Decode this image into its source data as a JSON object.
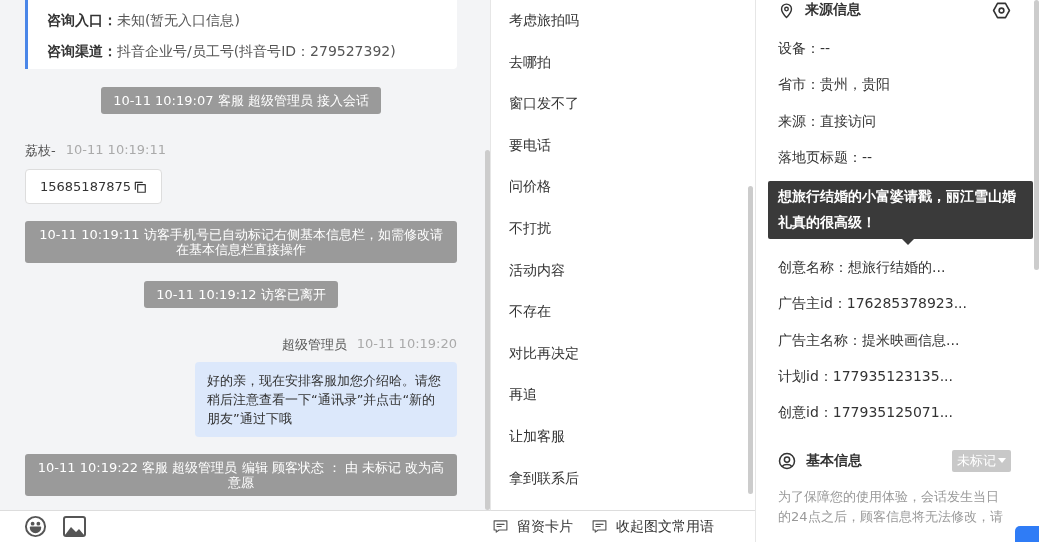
{
  "info_card": {
    "rows": [
      {
        "label": "咨询入口：",
        "value": "未知(暂无入口信息)"
      },
      {
        "label": "咨询渠道：",
        "value": "抖音企业号/员工号(抖音号ID：279527392)"
      }
    ]
  },
  "messages": [
    {
      "kind": "system",
      "text": "10-11 10:19:07 客服 超级管理员 接入会话"
    },
    {
      "kind": "received",
      "sender": "荔枝-",
      "time": "10-11 10:19:11",
      "text": "15685187875"
    },
    {
      "kind": "system",
      "text": "10-11 10:19:11 访客手机号已自动标记右侧基本信息栏，如需修改请在基本信息栏直接操作"
    },
    {
      "kind": "system",
      "text": "10-11 10:19:12 访客已离开"
    },
    {
      "kind": "sent",
      "sender": "超级管理员",
      "time": "10-11 10:19:20",
      "text": "好的亲，现在安排客服加您介绍哈。请您稍后注意查看一下“通讯录”并点击“新的朋友”通过下哦"
    },
    {
      "kind": "system",
      "text": "10-11 10:19:22 客服 超级管理员 编辑 顾客状态 ： 由 未标记 改为高意愿"
    }
  ],
  "quick_replies": [
    "考虑旅拍吗",
    "去哪拍",
    "窗口发不了",
    "要电话",
    "问价格",
    "不打扰",
    "活动内容",
    "不存在",
    "对比再决定",
    "再追",
    "让加客服",
    "拿到联系后"
  ],
  "toolbar": {
    "buttons": [
      "留资卡片",
      "收起图文常用语"
    ]
  },
  "source_info": {
    "title": "来源信息",
    "rows": [
      {
        "kind": "field",
        "text": "设备：--"
      },
      {
        "kind": "field",
        "text": "省市：贵州，贵阳"
      },
      {
        "kind": "field",
        "text": "来源：直接访问"
      },
      {
        "kind": "field",
        "text": "落地页标题：--"
      },
      {
        "kind": "tooltip",
        "text": "想旅行结婚的小富婆请戳，丽江雪山婚礼真的很高级！"
      },
      {
        "kind": "field",
        "text": "创意名称：想旅行结婚的..."
      },
      {
        "kind": "field",
        "text": "广告主id：176285378923..."
      },
      {
        "kind": "field",
        "text": "广告主名称：提米映画信息..."
      },
      {
        "kind": "field",
        "text": "计划id：177935123135..."
      },
      {
        "kind": "field",
        "text": "创意id：177935125071..."
      }
    ]
  },
  "basic_info": {
    "title": "基本信息",
    "status": "未标记",
    "note": "为了保障您的使用体验，会话发生当日的24点之后，顾客信息将无法修改，请"
  }
}
